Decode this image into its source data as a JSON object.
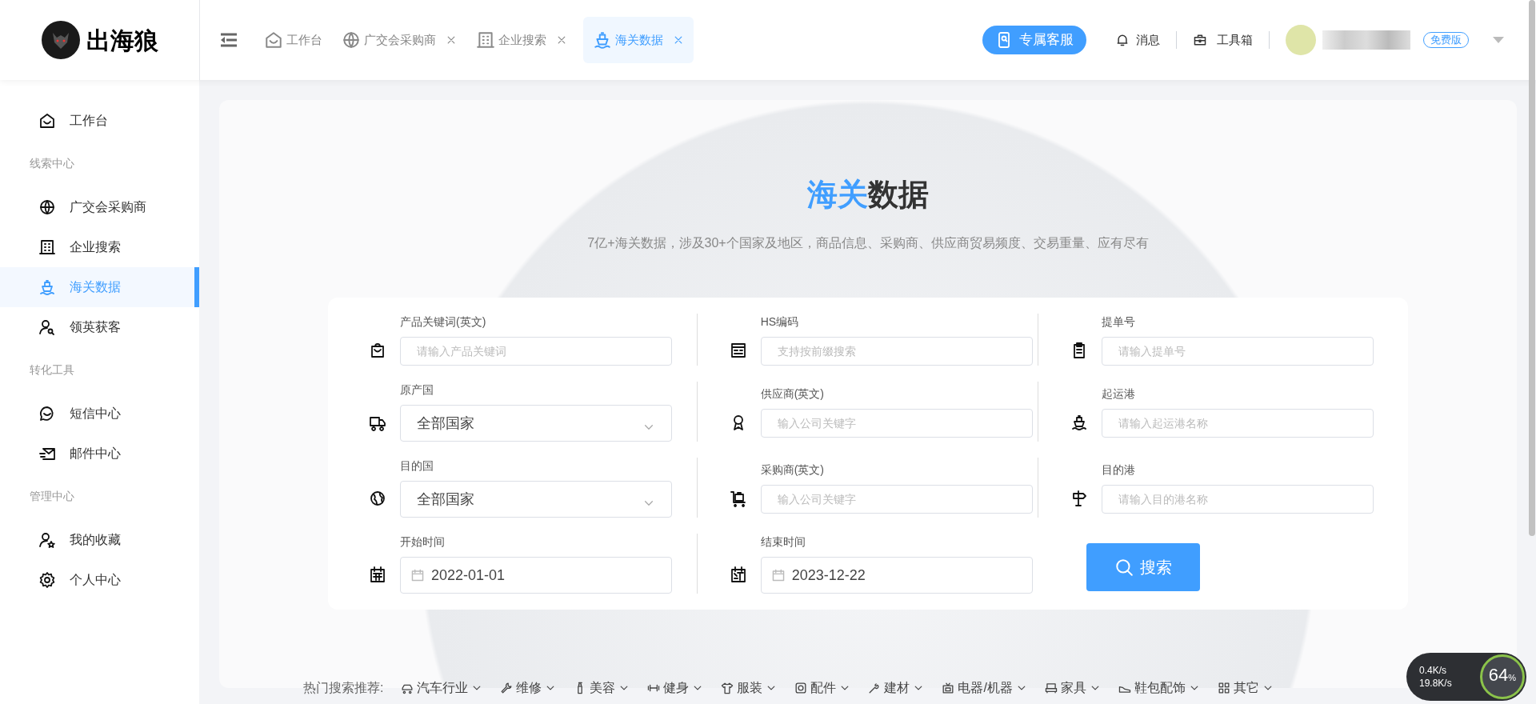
{
  "logo": {
    "text": "出海狼"
  },
  "tabs": [
    {
      "label": "工作台",
      "closable": false,
      "selected": false
    },
    {
      "label": "广交会采购商",
      "closable": true,
      "selected": false
    },
    {
      "label": "企业搜索",
      "closable": true,
      "selected": false
    },
    {
      "label": "海关数据",
      "closable": true,
      "selected": true
    }
  ],
  "header": {
    "service_button": "专属客服",
    "messages": "消息",
    "toolbox": "工具箱",
    "plan_badge": "免费版"
  },
  "sidebar": {
    "items": [
      {
        "kind": "item",
        "label": "工作台",
        "selected": false
      },
      {
        "kind": "group",
        "label": "线索中心"
      },
      {
        "kind": "item",
        "label": "广交会采购商",
        "selected": false
      },
      {
        "kind": "item",
        "label": "企业搜索",
        "selected": false
      },
      {
        "kind": "item",
        "label": "海关数据",
        "selected": true
      },
      {
        "kind": "item",
        "label": "领英获客",
        "selected": false
      },
      {
        "kind": "group",
        "label": "转化工具"
      },
      {
        "kind": "item",
        "label": "短信中心",
        "selected": false
      },
      {
        "kind": "item",
        "label": "邮件中心",
        "selected": false
      },
      {
        "kind": "group",
        "label": "管理中心"
      },
      {
        "kind": "item",
        "label": "我的收藏",
        "selected": false
      },
      {
        "kind": "item",
        "label": "个人中心",
        "selected": false
      }
    ]
  },
  "hero": {
    "title_highlight": "海关",
    "title_rest": "数据",
    "subtitle": "7亿+海关数据，涉及30+个国家及地区，商品信息、采购商、供应商贸易频度、交易重量、应有尽有"
  },
  "form": {
    "fields": [
      {
        "kind": "input",
        "label": "产品关键词(英文)",
        "placeholder": "请输入产品关键词"
      },
      {
        "kind": "input",
        "label": "HS编码",
        "placeholder": "支持按前缀搜索"
      },
      {
        "kind": "input",
        "label": "提单号",
        "placeholder": "请输入提单号"
      },
      {
        "kind": "select",
        "label": "原产国",
        "value": "全部国家"
      },
      {
        "kind": "input",
        "label": "供应商(英文)",
        "placeholder": "输入公司关键字"
      },
      {
        "kind": "input",
        "label": "起运港",
        "placeholder": "请输入起运港名称"
      },
      {
        "kind": "select",
        "label": "目的国",
        "value": "全部国家"
      },
      {
        "kind": "input",
        "label": "采购商(英文)",
        "placeholder": "输入公司关键字"
      },
      {
        "kind": "input",
        "label": "目的港",
        "placeholder": "请输入目的港名称"
      },
      {
        "kind": "date",
        "label": "开始时间",
        "value": "2022-01-01"
      },
      {
        "kind": "date",
        "label": "结束时间",
        "value": "2023-12-22"
      },
      {
        "kind": "button",
        "label": "搜索"
      }
    ]
  },
  "hot_search": {
    "label": "热门搜索推荐:",
    "items": [
      "汽车行业",
      "维修",
      "美容",
      "健身",
      "服装",
      "配件",
      "建材",
      "电器/机器",
      "家具",
      "鞋包配饰",
      "其它"
    ]
  },
  "speed_widget": {
    "upload": "0.4K/s",
    "download": "19.8K/s",
    "percent": "64",
    "unit": "%"
  }
}
